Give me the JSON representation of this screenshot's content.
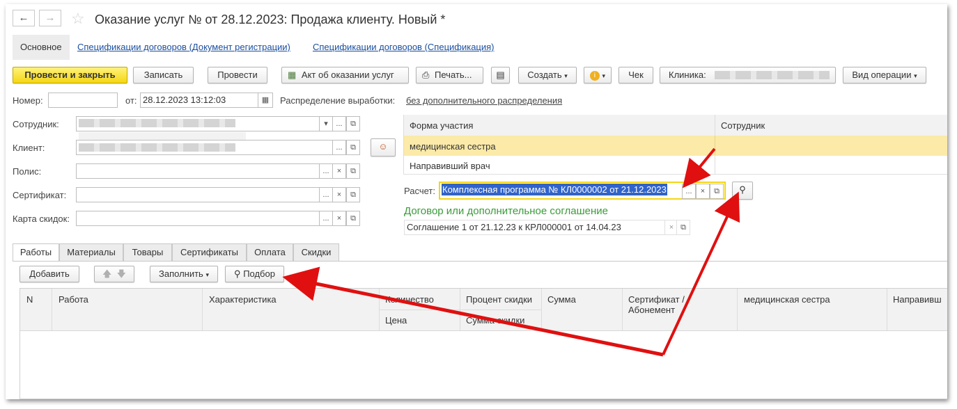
{
  "window": {
    "title": "Оказание услуг №  от 28.12.2023: Продажа клиенту.  Новый *",
    "back_icon": "arrow-left-icon",
    "forward_icon": "arrow-right-icon",
    "favorite_icon": "star-icon"
  },
  "nav_tabs": [
    {
      "label": "Основное"
    },
    {
      "label": "Спецификации договоров (Документ регистрации)"
    },
    {
      "label": "Спецификации договоров (Спецификация)"
    }
  ],
  "toolbar": {
    "post_close": "Провести и закрыть",
    "save": "Записать",
    "post": "Провести",
    "act": "Акт об оказании услуг",
    "print": "Печать...",
    "create": "Создать",
    "receipt": "Чек",
    "clinic_label": "Клиника:",
    "operation": "Вид операции"
  },
  "header_fields": {
    "number_label": "Номер:",
    "number_value": "",
    "from_label": "от:",
    "date_value": "28.12.2023 13:12:03",
    "distribution_label": "Распределение выработки:",
    "distribution_value": "без дополнительного распределения"
  },
  "left_fields": {
    "employee_label": "Сотрудник:",
    "client_label": "Клиент:",
    "policy_label": "Полис:",
    "certificate_label": "Сертификат:",
    "discount_card_label": "Карта скидок:"
  },
  "participation": {
    "col_form": "Форма участия",
    "col_employee": "Сотрудник",
    "rows": [
      {
        "form": "медицинская сестра",
        "employee": ""
      },
      {
        "form": "Направивший врач",
        "employee": ""
      }
    ]
  },
  "calculation": {
    "label": "Расчет:",
    "value": "Комплексная программа № КЛ0000002 от 21.12.2023",
    "contract_header": "Договор или дополнительное соглашение",
    "contract_value": "Соглашение 1 от 21.12.23 к КРЛ000001 от 14.04.23"
  },
  "bottom_tabs": [
    {
      "label": "Работы"
    },
    {
      "label": "Материалы"
    },
    {
      "label": "Товары"
    },
    {
      "label": "Сертификаты"
    },
    {
      "label": "Оплата"
    },
    {
      "label": "Скидки"
    }
  ],
  "works_toolbar": {
    "add": "Добавить",
    "fill": "Заполнить",
    "pick": "Подбор"
  },
  "works_table": {
    "col_n": "N",
    "col_work": "Работа",
    "col_char": "Характеристика",
    "col_qty": "Количество",
    "col_price": "Цена",
    "col_discount_pct": "Процент скидки",
    "col_discount_sum": "Сумма скидки",
    "col_sum": "Сумма",
    "col_cert": "Сертификат /\nАбонемент",
    "col_nurse": "медицинская сестра",
    "col_referring": "Направивш"
  },
  "colors": {
    "primary_button": "#f4d614",
    "link": "#1a4e9e",
    "selected_row": "#fbeaa8",
    "contract_header": "#3a9b3a",
    "arrow": "#e01010",
    "selection": "#3163c9"
  }
}
